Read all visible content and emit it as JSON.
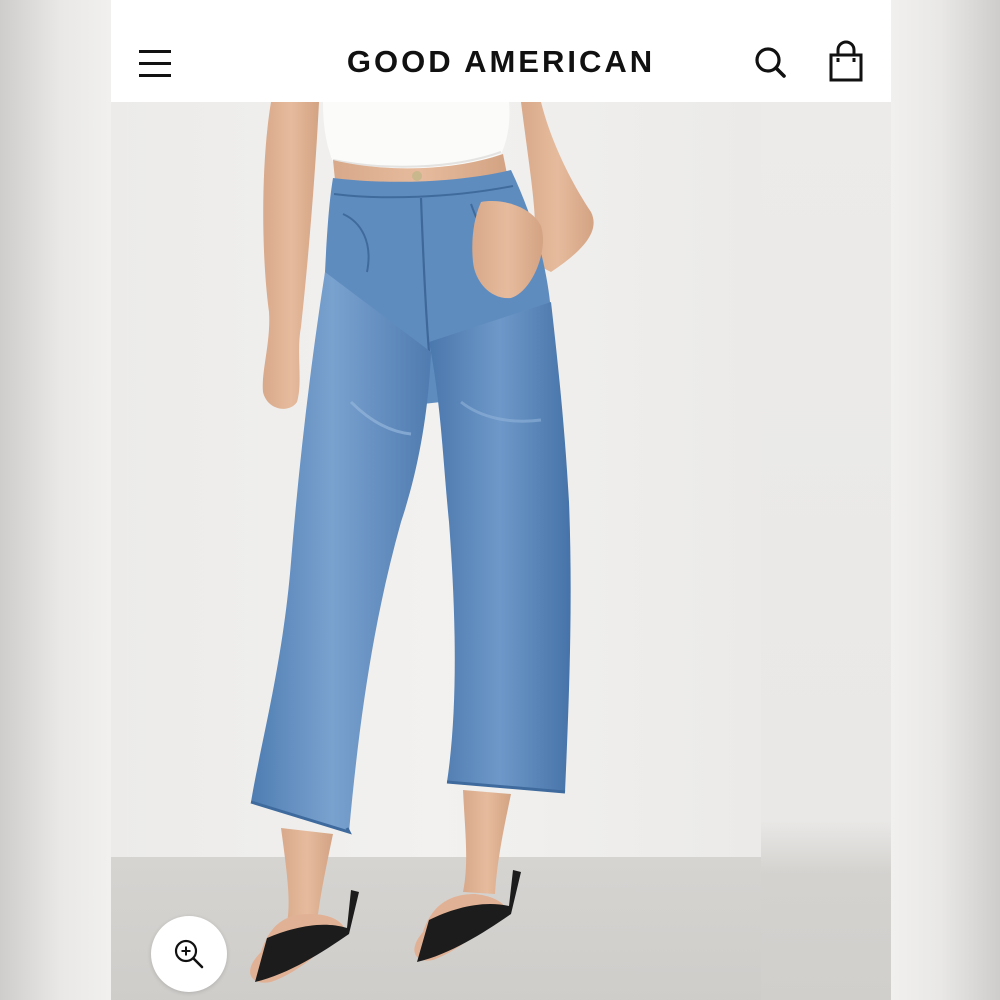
{
  "header": {
    "brand": "GOOD AMERICAN",
    "menu_icon": "hamburger-menu-icon",
    "search_icon": "search-icon",
    "bag_icon": "shopping-bag-icon"
  },
  "gallery": {
    "zoom_icon": "zoom-in-icon"
  },
  "colors": {
    "header_bg": "#ffffff",
    "brand_text": "#111111",
    "denim": "#5a86b8",
    "background": "#f1f0ee"
  }
}
